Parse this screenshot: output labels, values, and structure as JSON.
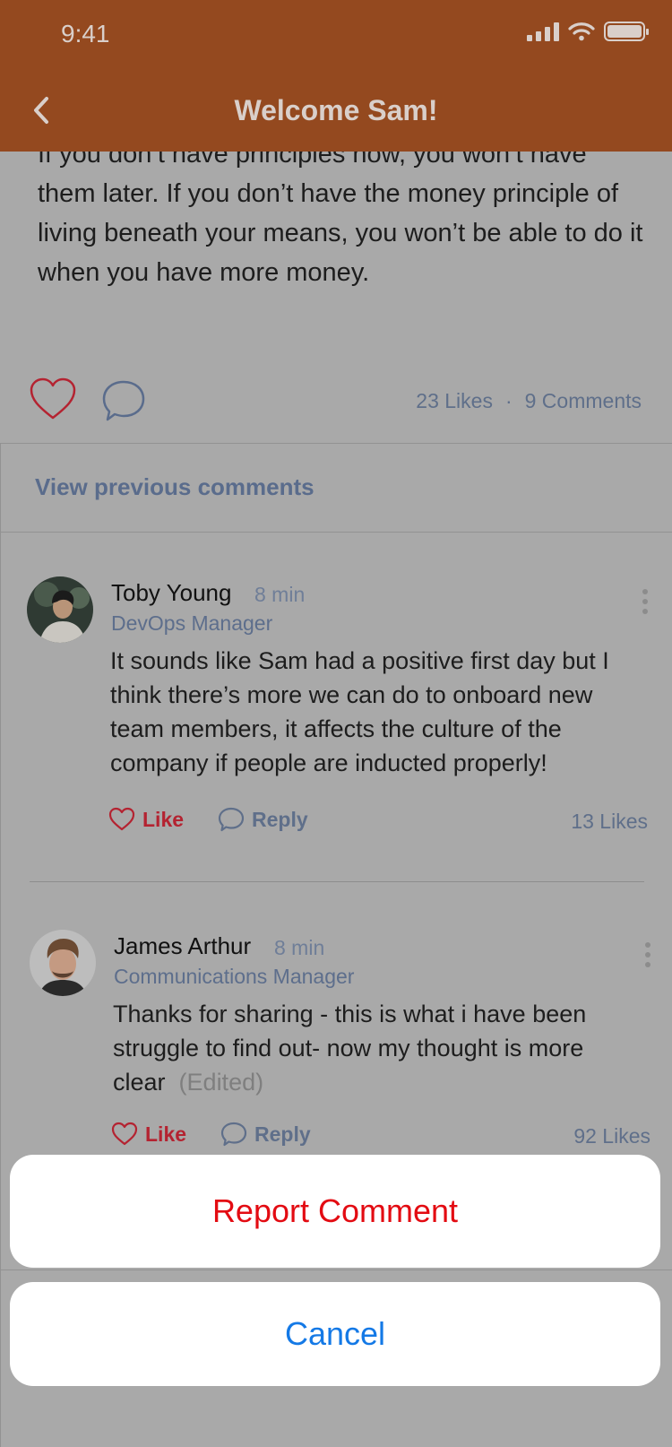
{
  "status_bar": {
    "time": "9:41"
  },
  "header": {
    "title": "Welcome Sam!"
  },
  "post": {
    "text": "If you don’t have principles now, you won’t have them later. If you don’t have the money principle of living beneath your means, you won’t be able to do it when you have more money.",
    "likes": "23 Likes",
    "separator": "·",
    "comments": "9 Comments"
  },
  "view_previous": "View previous comments",
  "comments": [
    {
      "name": "Toby Young",
      "time": "8 min",
      "role": "DevOps Manager",
      "text": "It sounds like Sam had a positive first day but I think there’s more we can do to onboard new team members, it affects the culture of the company if people are inducted properly!",
      "like_label": "Like",
      "reply_label": "Reply",
      "likes": "13 Likes"
    },
    {
      "name": "James Arthur",
      "time": "8 min",
      "role": "Communications Manager",
      "text": "Thanks for sharing - this is what i have been struggle to find out- now my thought is more clear",
      "edited": "(Edited)",
      "like_label": "Like",
      "reply_label": "Reply",
      "likes": "92 Likes"
    }
  ],
  "action_sheet": {
    "report_label": "Report Comment",
    "cancel_label": "Cancel"
  },
  "colors": {
    "header_bg": "#94491f",
    "overlay_bg": "#a9a9a9",
    "like_red": "#b42331",
    "report_red": "#e30b12",
    "cancel_blue": "#1479e6"
  }
}
